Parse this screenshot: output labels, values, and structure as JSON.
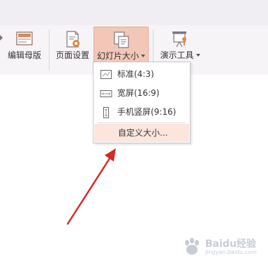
{
  "ribbon": {
    "buttons": [
      {
        "label": "编辑母版",
        "icon": "slide-master-icon"
      },
      {
        "label": "页面设置",
        "icon": "page-setup-icon"
      },
      {
        "label": "幻灯片大小",
        "icon": "slide-size-icon",
        "has_dropdown": true,
        "active": true
      },
      {
        "label": "演示工具",
        "icon": "presentation-tools-icon",
        "has_dropdown": true
      }
    ]
  },
  "dropdown": {
    "items": [
      {
        "label": "标准(4:3)",
        "icon": "standard-ratio-icon"
      },
      {
        "label": "宽屏(16:9)",
        "icon": "widescreen-ratio-icon"
      },
      {
        "label": "手机竖屏(9:16)",
        "icon": "phone-portrait-ratio-icon"
      },
      {
        "label": "自定义大小...",
        "icon": null,
        "highlighted": true
      }
    ]
  },
  "annotation": {
    "arrow_color": "#d42a2a"
  },
  "colors": {
    "accent_active": "#f2c7b7",
    "hover_item": "#fbe5dc",
    "ribbon_bg": "#f6f4f7"
  },
  "watermark": {
    "text": "Baidu经验",
    "sub": "jingyan.baidu.com"
  }
}
